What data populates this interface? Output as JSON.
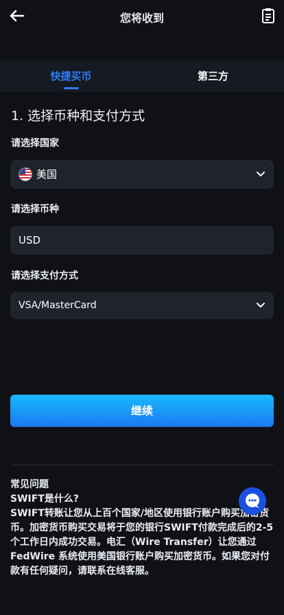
{
  "header": {
    "title": "您将收到"
  },
  "tabs": [
    {
      "label": "快捷买币",
      "active": true
    },
    {
      "label": "第三方",
      "active": false
    }
  ],
  "form": {
    "section_title": "1. 选择币种和支付方式",
    "country": {
      "label": "请选择国家",
      "value": "美国",
      "icon": "us-flag-icon"
    },
    "currency": {
      "label": "请选择币种",
      "value": "USD"
    },
    "payment": {
      "label": "请选择支付方式",
      "value": "VSA/MasterCard"
    }
  },
  "actions": {
    "continue_label": "继续"
  },
  "faq": {
    "heading": "常见问题",
    "question": "SWIFT是什么?",
    "answer": "SWIFT转账让您从上百个国家/地区使用银行账户购买加密货币。加密货币购买交易将于您的银行SWIFT付款完成后的2-5个工作日内成功交易。电汇（Wire Transfer）让您通过FedWire 系统使用美国银行账户购买加密货币。如果您对付款有任何疑问，请联系在线客服。"
  },
  "colors": {
    "background": "#0f1116",
    "accent": "#2f7cf6",
    "field": "#1f232c"
  }
}
